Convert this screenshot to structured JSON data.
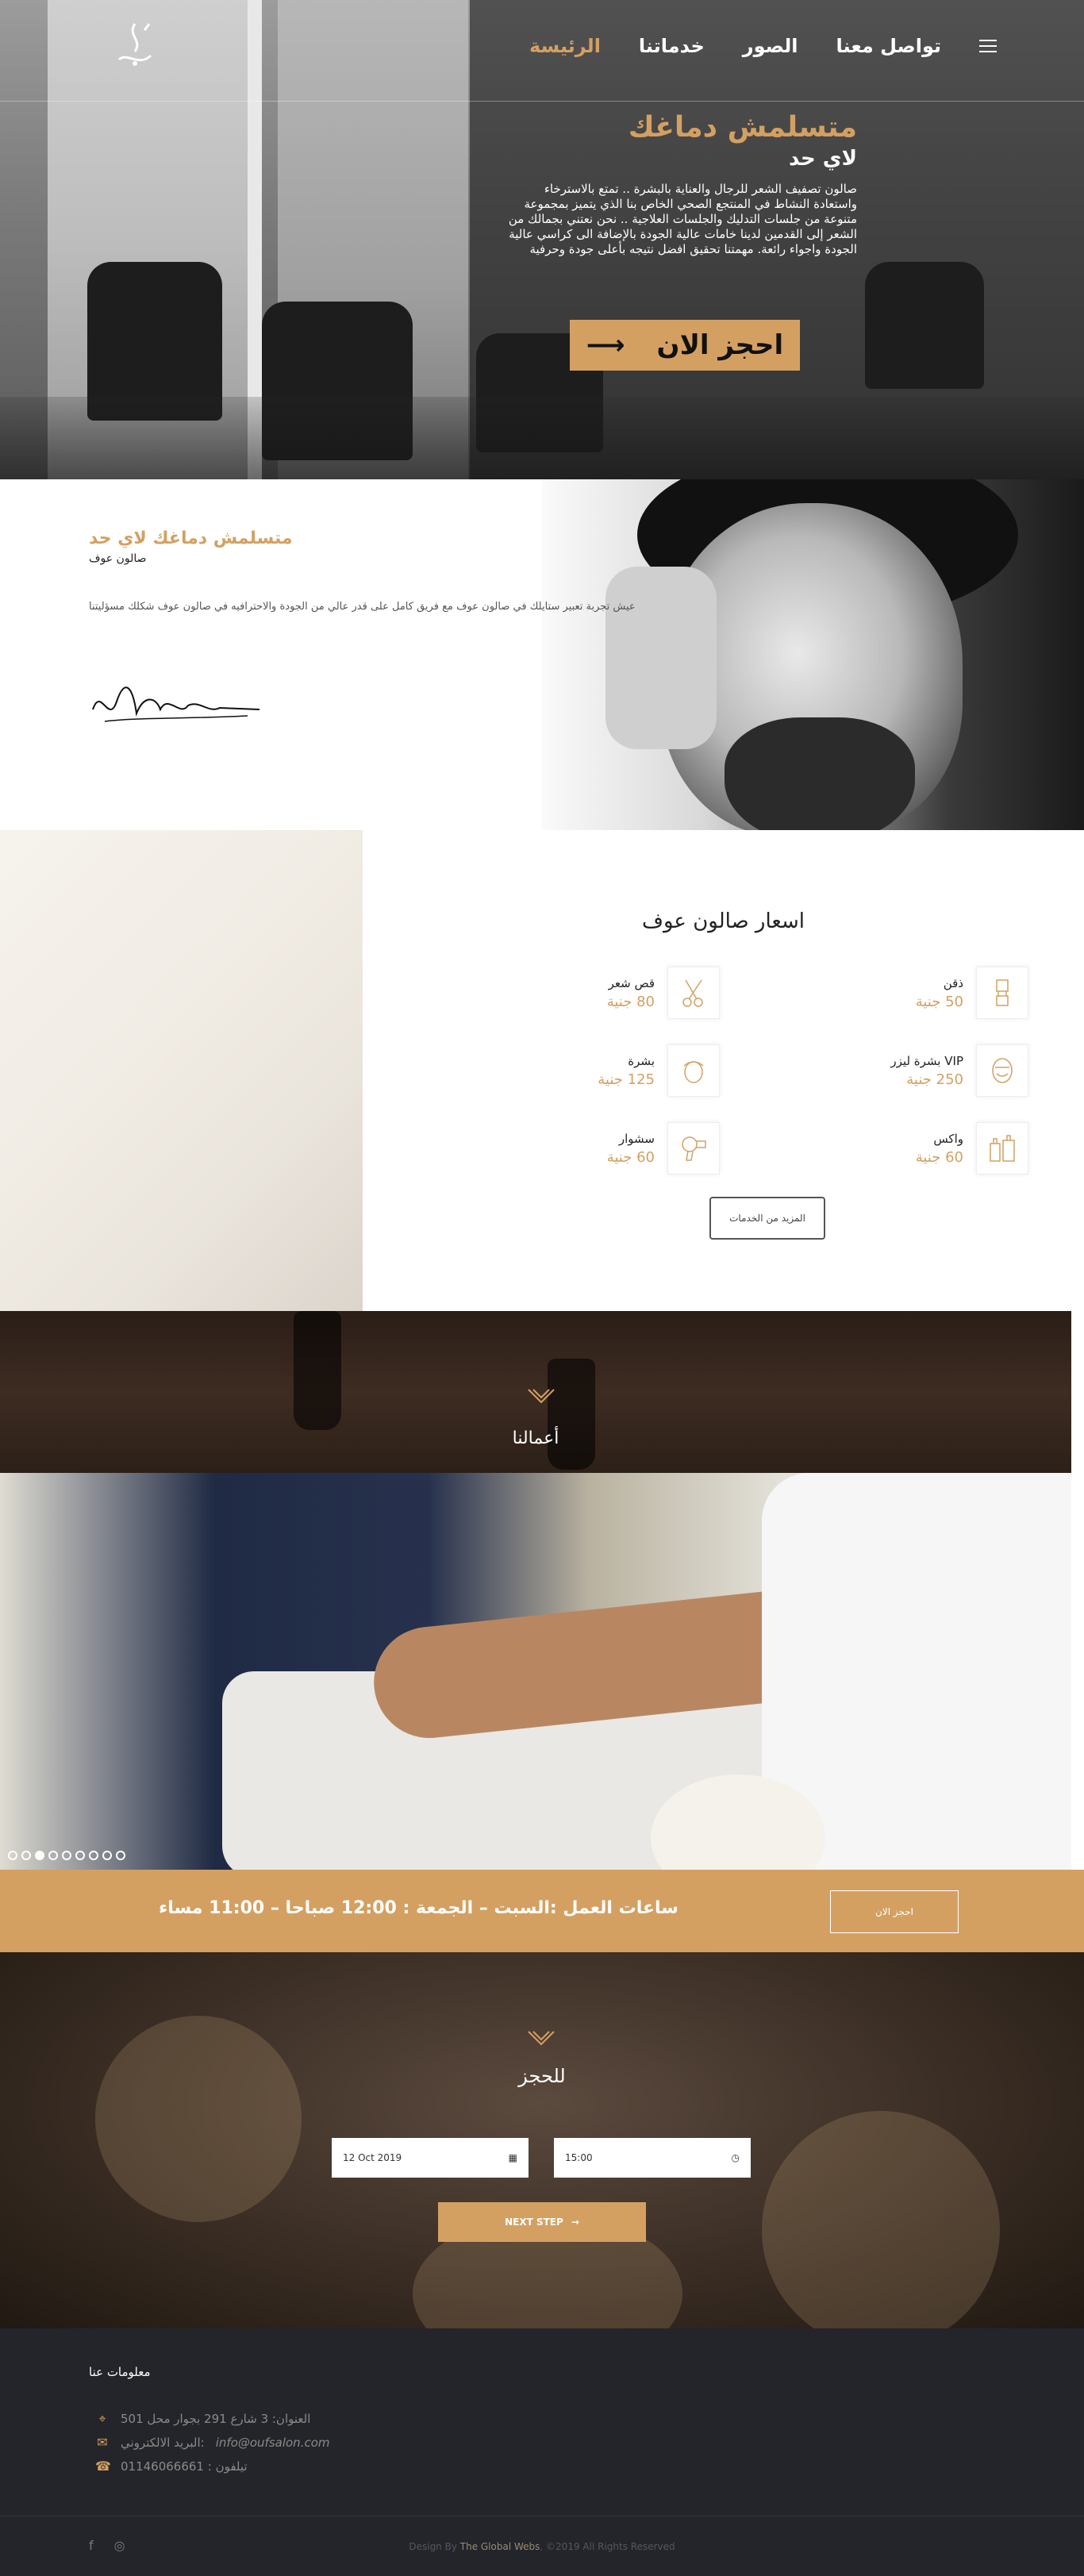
{
  "nav": {
    "items": [
      "الرئيسة",
      "خدماتنا",
      "الصور",
      "تواصل معنا"
    ],
    "active_index": 0,
    "menu_icon": "hamburger-icon"
  },
  "hero": {
    "title": "متسلمش دماغك",
    "subtitle": "لاي حد",
    "body": "صالون تصفيف الشعر للرجال والعناية بالبشرة .. تمتع بالاسترخاء واستعادة النشاط في المنتجع الصحي الخاص بنا الذي يتميز بمجموعة متنوعة من جلسات التدليك والجلسات العلاجية .. نحن نعتني بجمالك من الشعر إلى القدمين لدينا خامات عالية الجودة بالإضافة الى كراسي عالية الجودة واجواء رائعة. مهمتنا تحقيق افضل نتيجه بأعلى جودة وحرفية",
    "book_button": "احجز الان",
    "book_arrow_icon": "arrow-right-icon"
  },
  "about": {
    "title": "متسلمش دماغك لاي حد",
    "subtitle": "صالون عوف",
    "body": "عيش تجربة تعبير ستايلك في صالون عوف مع فريق كامل على قدر عالي من الجودة والاحترافيه في صالون عوف شكلك مسؤليتنا"
  },
  "prices": {
    "title": "اسعار صالون عوف",
    "services": [
      {
        "name": "ذقن",
        "price": "50 جنية",
        "icon": "shaving-brush-icon"
      },
      {
        "name": "قص شعر",
        "price": "80 جنية",
        "icon": "scissors-comb-icon"
      },
      {
        "name": "VIP بشرة ليزر",
        "price": "250 جنية",
        "icon": "face-mask-icon"
      },
      {
        "name": "بشرة",
        "price": "125 جنية",
        "icon": "face-towel-icon"
      },
      {
        "name": "واكس",
        "price": "60 جنية",
        "icon": "wax-bottles-icon"
      },
      {
        "name": "سشوار",
        "price": "60 جنية",
        "icon": "hair-dryer-icon"
      }
    ],
    "more_button": "المزيد من الخدمات"
  },
  "works": {
    "title": "أعمالنا",
    "emblem_icon": "razor-emblem-icon",
    "slides": 9,
    "active_slide": 2
  },
  "hours": {
    "text": "ساعات العمل  :السبت – الجمعة : 12:00 صباحا  –  11:00 مساء",
    "button": "احجز الان"
  },
  "booking": {
    "title": "للحجز",
    "date_value": "12 Oct 2019",
    "date_icon": "calendar-icon",
    "time_value": "15:00",
    "time_icon": "clock-icon",
    "next_button": "NEXT STEP",
    "next_icon": "arrow-right-icon"
  },
  "footer": {
    "heading": "معلومات عنا",
    "address": "العنوان: 3 شارع 291 بجوار محل 501",
    "email_label": "البريد الالكتروني:",
    "email": "info@oufsalon.com",
    "phone": "تيلفون : 01146066661",
    "social": [
      "facebook-icon",
      "instagram-icon"
    ],
    "credit_prefix": "Design By",
    "credit_brand": "The Global Webs",
    "credit_suffix": ", ©2019 All Rights Reserved"
  },
  "colors": {
    "accent": "#d4a062",
    "footer_bg": "#24252a"
  }
}
